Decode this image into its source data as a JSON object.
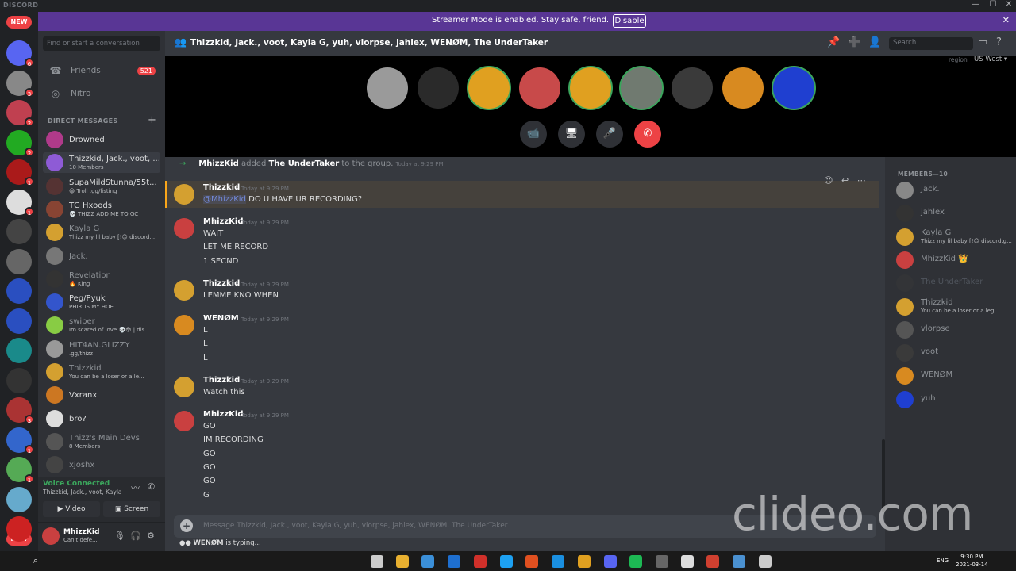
{
  "app": {
    "name": "DISCORD",
    "window_controls": [
      "—",
      "☐",
      "✕"
    ]
  },
  "banner": {
    "text": "Streamer Mode is enabled. Stay safe, friend.",
    "button": "Disable",
    "close": "✕"
  },
  "servers": [
    {
      "color": "#5865f2",
      "badge": "6"
    },
    {
      "color": "#888888",
      "badge": "3"
    },
    {
      "color": "#c04050",
      "badge": "2"
    },
    {
      "color": "#22aa22",
      "badge": "2"
    },
    {
      "color": "#aa1a1a",
      "badge": "1"
    },
    {
      "color": "#dddddd",
      "badge": "1"
    },
    {
      "color": "#444444",
      "badge": ""
    },
    {
      "color": "#666666",
      "badge": ""
    },
    {
      "color": "#2a4fc0",
      "badge": ""
    },
    {
      "color": "#2a4fc0",
      "badge": ""
    },
    {
      "color": "#1a8a8a",
      "badge": ""
    },
    {
      "color": "#333333",
      "badge": ""
    },
    {
      "color": "#aa3333",
      "badge": "3"
    },
    {
      "color": "#3366cc",
      "badge": "1"
    },
    {
      "color": "#55aa55",
      "badge": "1"
    },
    {
      "color": "#66aacc",
      "badge": ""
    },
    {
      "color": "#cc2222",
      "badge": ""
    }
  ],
  "new_pill_top": "NEW",
  "new_pill_bottom": "NEW",
  "dm_sidebar": {
    "search_placeholder": "Find or start a conversation",
    "friends_label": "Friends",
    "friends_count": "521",
    "nitro_label": "Nitro",
    "section_header": "DIRECT MESSAGES",
    "add": "+",
    "items": [
      {
        "name": "Drowned",
        "sub": "",
        "color": "#b03a8a",
        "active": false,
        "dim": false
      },
      {
        "name": "Thizzkid, Jack., voot, ...",
        "sub": "10 Members",
        "color": "#8e5bd6",
        "active": true,
        "dim": false
      },
      {
        "name": "SupaMildStunna/55t...",
        "sub": "😀 Troll .gg/listing",
        "color": "#553333",
        "active": false,
        "dim": false
      },
      {
        "name": "TG Hxoods",
        "sub": "💀 THIZZ ADD ME TO GC",
        "color": "#884433",
        "active": false,
        "dim": false
      },
      {
        "name": "Kayla G",
        "sub": "Thizz my lil baby [!😊 discord...",
        "color": "#d4a030",
        "active": false,
        "dim": true
      },
      {
        "name": "Jack.",
        "sub": "",
        "color": "#777777",
        "active": false,
        "dim": true
      },
      {
        "name": "Revelation",
        "sub": "🔥 King",
        "color": "#333333",
        "active": false,
        "dim": true
      },
      {
        "name": "Peg/Pyuk",
        "sub": "PHIRUS MY HOE",
        "color": "#3355cc",
        "active": false,
        "dim": false
      },
      {
        "name": "swiper",
        "sub": "Im scared of love 💀😳 | dis...",
        "color": "#88cc44",
        "active": false,
        "dim": true
      },
      {
        "name": "HIT4AN.GLIZZY",
        "sub": ".gg/thizz",
        "color": "#999999",
        "active": false,
        "dim": true
      },
      {
        "name": "Thizzkid",
        "sub": "You can be a loser or a le...",
        "color": "#d4a030",
        "active": false,
        "dim": true
      },
      {
        "name": "Vxranx",
        "sub": "",
        "color": "#cc7722",
        "active": false,
        "dim": false
      },
      {
        "name": "bro?",
        "sub": "",
        "color": "#dddddd",
        "active": false,
        "dim": false
      },
      {
        "name": "Thizz's Main Devs",
        "sub": "8 Members",
        "color": "#555555",
        "active": false,
        "dim": true
      },
      {
        "name": "xjoshx",
        "sub": "",
        "color": "#444444",
        "active": false,
        "dim": true
      }
    ]
  },
  "voice": {
    "title": "Voice Connected",
    "sub": "Thizzkid, Jack., voot, Kayla ...",
    "video_label": "Video",
    "screen_label": "Screen"
  },
  "user": {
    "name": "MhizzKid",
    "status": "Can't defe..."
  },
  "header": {
    "title": "Thizzkid, Jack., voot, Kayla G, yuh, vlorpse, jahlex, WENØM, The UnderTaker",
    "search_placeholder": "Search",
    "region_label": "region",
    "region_value": "US West"
  },
  "call_participants": [
    {
      "color": "#9a9a9a",
      "speaking": false
    },
    {
      "color": "#2a2a2a",
      "speaking": false
    },
    {
      "color": "#e0a020",
      "speaking": true
    },
    {
      "color": "#c84a4a",
      "speaking": false
    },
    {
      "color": "#e0a020",
      "speaking": true
    },
    {
      "color": "#707a70",
      "speaking": true
    },
    {
      "color": "#3a3a3a",
      "speaking": false
    },
    {
      "color": "#d88a20",
      "speaking": false
    },
    {
      "color": "#1f3fd0",
      "speaking": true
    }
  ],
  "call_controls": [
    "📹",
    "🖥",
    "🎤",
    "✆"
  ],
  "system_message": {
    "actor": "MhizzKid",
    "verb": "added",
    "target": "The UnderTaker",
    "suffix": "to the group.",
    "time": "Today at 9:29 PM"
  },
  "messages": [
    {
      "author": "Thizzkid",
      "time": "Today at 9:29 PM",
      "color": "#d4a030",
      "mention": "@MhizzKid",
      "lines": [
        "DO U HAVE UR RECORDING?"
      ]
    },
    {
      "author": "MhizzKid",
      "time": "Today at 9:29 PM",
      "color": "#c94040",
      "mention": "",
      "lines": [
        "WAIT",
        "LET ME RECORD",
        "1 SECND"
      ]
    },
    {
      "author": "Thizzkid",
      "time": "Today at 9:29 PM",
      "color": "#d4a030",
      "mention": "",
      "lines": [
        "LEMME KNO WHEN"
      ]
    },
    {
      "author": "WENØM",
      "time": "Today at 9:29 PM",
      "color": "#d88a20",
      "mention": "",
      "lines": [
        "L",
        "L",
        "L"
      ]
    },
    {
      "author": "Thizzkid",
      "time": "Today at 9:29 PM",
      "color": "#d4a030",
      "mention": "",
      "lines": [
        "Watch this"
      ]
    },
    {
      "author": "MhizzKid",
      "time": "Today at 9:29 PM",
      "color": "#c94040",
      "mention": "",
      "lines": [
        "GO",
        "IM RECORDING",
        "GO",
        "GO",
        "GO",
        "G"
      ]
    }
  ],
  "composer_placeholder": "Message Thizzkid, Jack., voot, Kayla G, yuh, vlorpse, jahlex, WENØM, The UnderTaker",
  "typing": {
    "user": "WENØM",
    "text": "is typing..."
  },
  "members": {
    "header": "MEMBERS—10",
    "list": [
      {
        "name": "Jack.",
        "sub": "",
        "color": "#888888",
        "faded": false
      },
      {
        "name": "jahlex",
        "sub": "",
        "color": "#333333",
        "faded": false
      },
      {
        "name": "Kayla G",
        "sub": "Thizz my lil baby [!😊 discord.g...",
        "color": "#d4a030",
        "faded": false
      },
      {
        "name": "MhizzKid 👑",
        "sub": "",
        "color": "#c94040",
        "faded": false
      },
      {
        "name": "The UnderTaker",
        "sub": "",
        "color": "#3a3a3a",
        "faded": true
      },
      {
        "name": "Thizzkid",
        "sub": "You can be a loser or a leg...",
        "color": "#d4a030",
        "faded": false
      },
      {
        "name": "vlorpse",
        "sub": "",
        "color": "#555555",
        "faded": false
      },
      {
        "name": "voot",
        "sub": "",
        "color": "#3a3a3a",
        "faded": false
      },
      {
        "name": "WENØM",
        "sub": "",
        "color": "#d88a20",
        "faded": false
      },
      {
        "name": "yuh",
        "sub": "",
        "color": "#1f3fd0",
        "faded": false
      }
    ]
  },
  "watermark": "clideo.com",
  "taskbar": {
    "lang": "ENG",
    "time": "9:30 PM",
    "date": "2021-03-14"
  }
}
